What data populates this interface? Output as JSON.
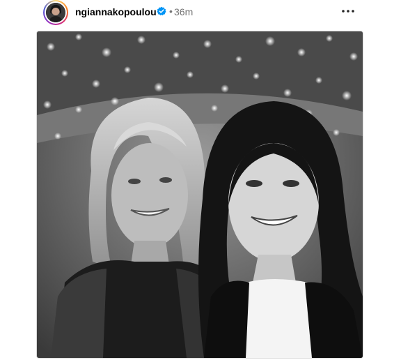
{
  "post": {
    "username": "ngiannakopoulou",
    "separator": "•",
    "time": "36m",
    "verified_icon": "verified-badge-icon",
    "more_icon": "more-horizontal-icon"
  },
  "colors": {
    "verified": "#0095f6",
    "meta_text": "#737373",
    "story_ring": [
      "#feda75",
      "#fa7e1e",
      "#d62976",
      "#962fbf",
      "#4f5bd5"
    ]
  }
}
